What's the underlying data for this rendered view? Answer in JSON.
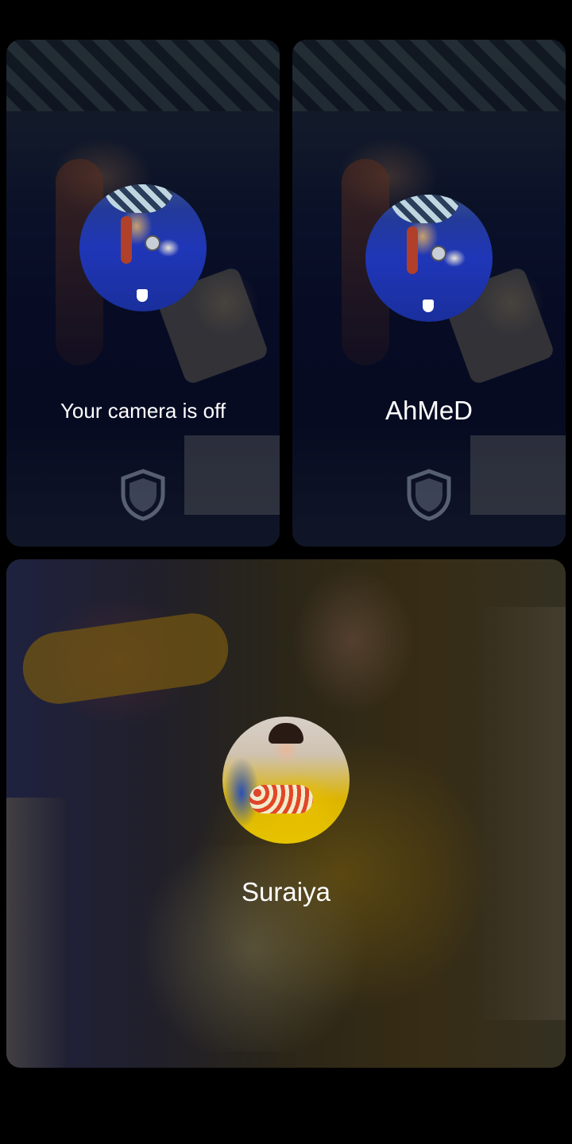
{
  "participants": {
    "self": {
      "label": "Your camera is off",
      "shield_icon": "shield-icon"
    },
    "ahmed": {
      "name": "AhMeD",
      "shield_icon": "shield-icon"
    },
    "suraiya": {
      "name": "Suraiya"
    }
  },
  "colors": {
    "background": "#000000",
    "label_text": "#ffffff"
  }
}
